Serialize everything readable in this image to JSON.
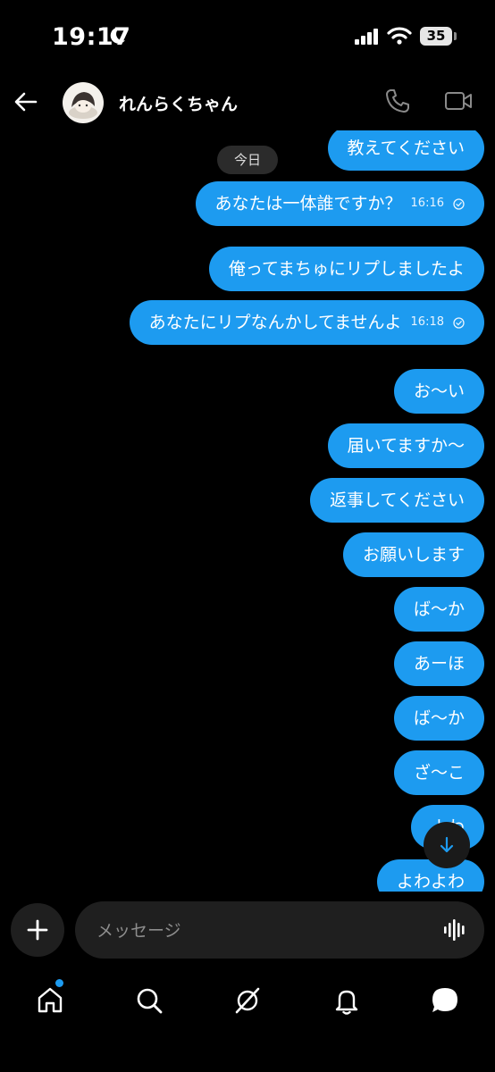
{
  "status_bar": {
    "time": "19:17",
    "battery": "35"
  },
  "header": {
    "contact_name": "れんらくちゃん"
  },
  "day_separator": "今日",
  "messages": [
    {
      "text": "教えてください",
      "time": ""
    },
    {
      "text": "あなたは一体誰ですか？",
      "time": "16:16"
    },
    {
      "text": "俺ってまちゅにリプしましたよ",
      "time": ""
    },
    {
      "text": "あなたにリプなんかしてませんよ",
      "time": "16:18"
    },
    {
      "text": "お〜い",
      "time": ""
    },
    {
      "text": "届いてますか〜",
      "time": ""
    },
    {
      "text": "返事してください",
      "time": ""
    },
    {
      "text": "お願いします",
      "time": ""
    },
    {
      "text": "ば〜か",
      "time": ""
    },
    {
      "text": "あーほ",
      "time": ""
    },
    {
      "text": "ば〜か",
      "time": ""
    },
    {
      "text": "ざ〜こ",
      "time": ""
    },
    {
      "text": "よわ",
      "time": ""
    },
    {
      "text": "よわよわ",
      "time": ""
    }
  ],
  "composer": {
    "placeholder": "メッセージ",
    "value": ""
  },
  "colors": {
    "accent": "#1d9bf0",
    "background": "#000000",
    "surface": "#1f1f1f"
  }
}
